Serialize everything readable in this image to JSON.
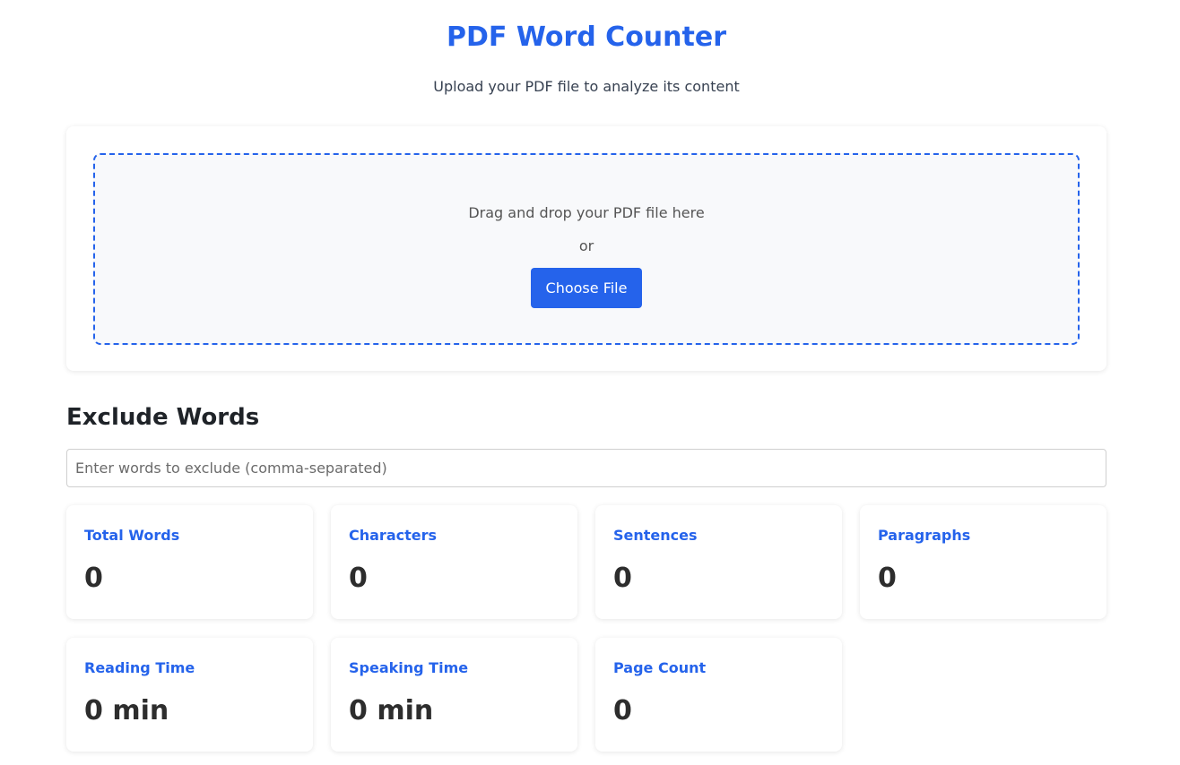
{
  "header": {
    "title": "PDF Word Counter",
    "subtitle": "Upload your PDF file to analyze its content"
  },
  "upload": {
    "drop_text": "Drag and drop your PDF file here",
    "or_text": "or",
    "choose_button": "Choose File"
  },
  "exclude": {
    "heading": "Exclude Words",
    "input_value": "",
    "placeholder": "Enter words to exclude (comma-separated)"
  },
  "stats": [
    {
      "label": "Total Words",
      "value": "0"
    },
    {
      "label": "Characters",
      "value": "0"
    },
    {
      "label": "Sentences",
      "value": "0"
    },
    {
      "label": "Paragraphs",
      "value": "0"
    },
    {
      "label": "Reading Time",
      "value": "0 min"
    },
    {
      "label": "Speaking Time",
      "value": "0 min"
    },
    {
      "label": "Page Count",
      "value": "0"
    }
  ],
  "colors": {
    "accent": "#2563eb",
    "dropzone_bg": "#f8f9fb",
    "text_dark": "#2d2d2d"
  }
}
